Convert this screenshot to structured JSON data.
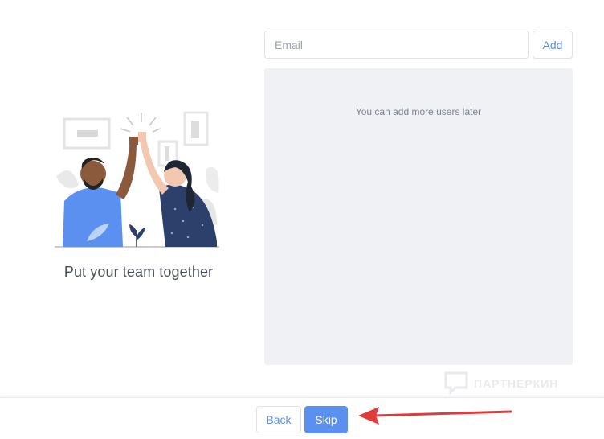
{
  "left": {
    "tagline": "Put your team together",
    "illustration_icon": "high-five-illustration"
  },
  "invite": {
    "email_placeholder": "Email",
    "email_value": "",
    "add_label": "Add",
    "empty_hint": "You can add more users later"
  },
  "footer": {
    "back_label": "Back",
    "skip_label": "Skip"
  },
  "watermark": {
    "text": "ПАРТНЕРКИН"
  },
  "annotation": {
    "arrow_icon": "red-arrow-pointing-left",
    "color": "#e03a3a"
  },
  "colors": {
    "accent": "#5b8ff0",
    "panel": "#f0f1f5"
  }
}
